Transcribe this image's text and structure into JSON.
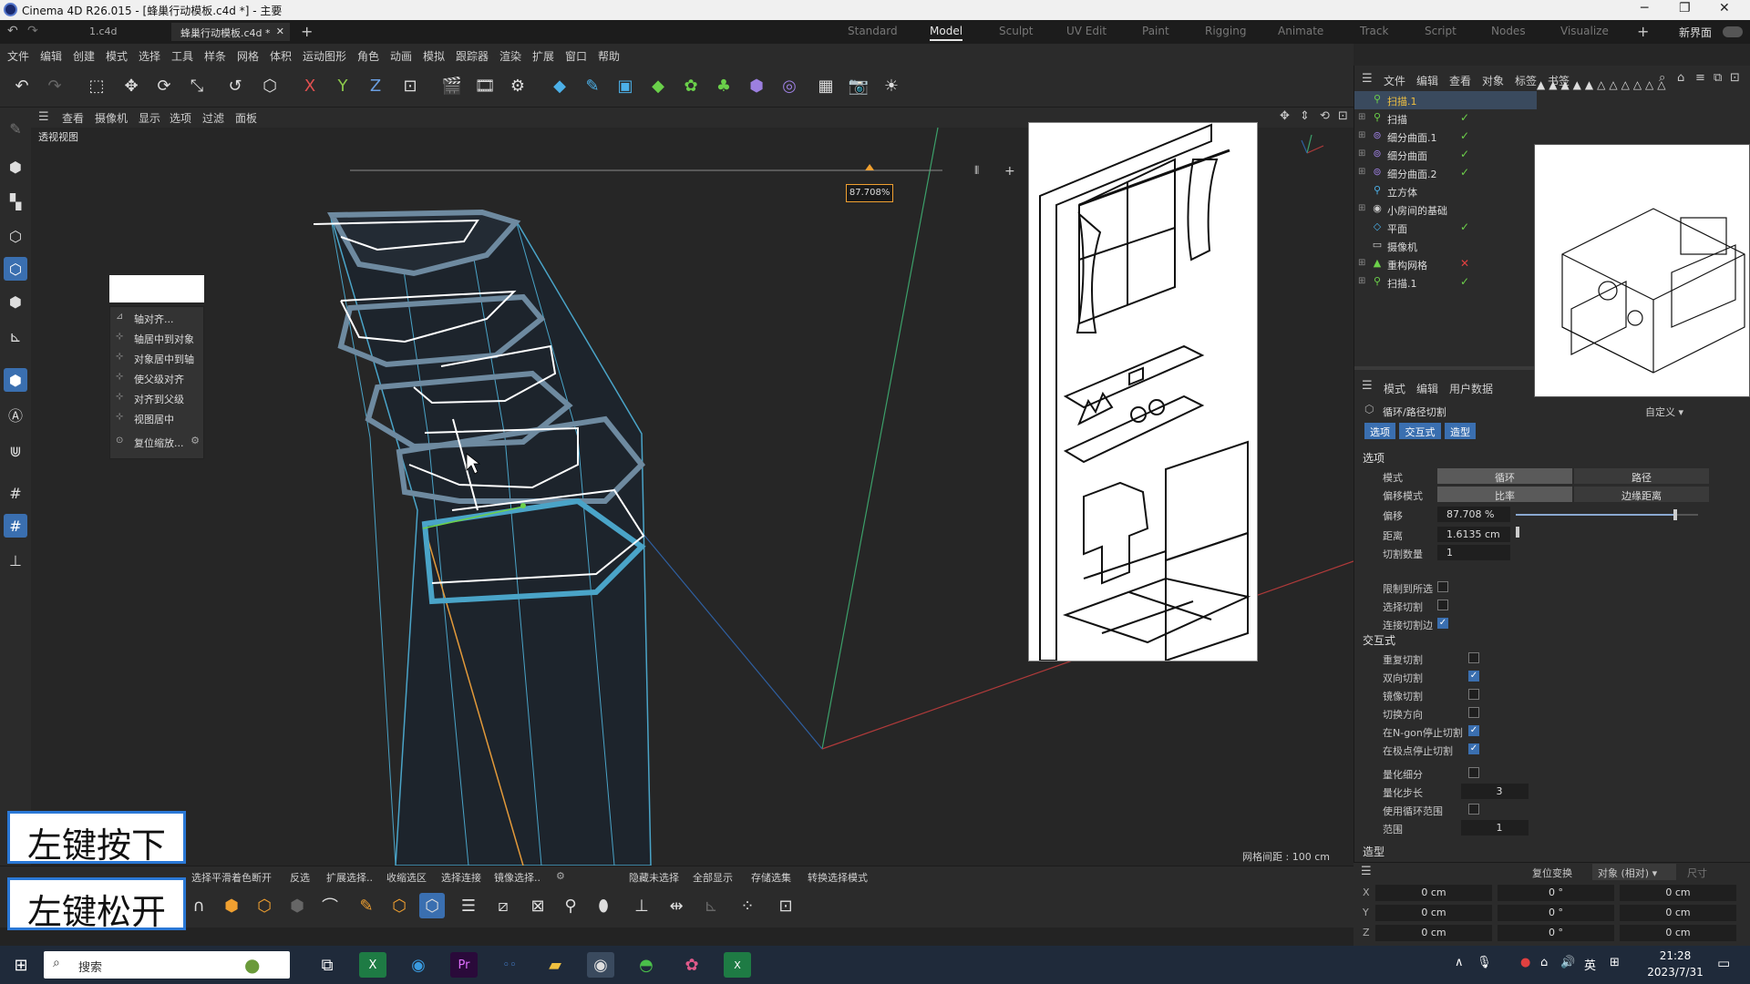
{
  "app": {
    "title": "Cinema 4D R26.015 - [蜂巢行动模板.c4d *] - 主要",
    "doc_tabs": [
      "1.c4d",
      "蜂巢行动模板.c4d *"
    ],
    "layouts": [
      "Standard",
      "Model",
      "Sculpt",
      "UV Edit",
      "Paint",
      "Rigging",
      "Animate",
      "Track",
      "Script",
      "Nodes",
      "Visualize"
    ],
    "active_layout": "Model",
    "new_interface": "新界面"
  },
  "menu": [
    "文件",
    "编辑",
    "创建",
    "模式",
    "选择",
    "工具",
    "样条",
    "网格",
    "体积",
    "运动图形",
    "角色",
    "动画",
    "模拟",
    "跟踪器",
    "渲染",
    "扩展",
    "窗口",
    "帮助"
  ],
  "toolbar": {
    "axis_labels": [
      "X",
      "Y",
      "Z"
    ]
  },
  "viewport": {
    "menu": [
      "查看",
      "摄像机",
      "显示",
      "选项",
      "过滤",
      "面板"
    ],
    "name": "透视视图",
    "percent_badge": "87.708%",
    "grid_spacing": "网格间距 : 100 cm",
    "slider_ratio": 0.87708
  },
  "context_menu": {
    "items": [
      "轴对齐...",
      "轴居中到对象",
      "对象居中到轴",
      "使父级对齐",
      "对齐到父级",
      "视图居中",
      "复位缩放..."
    ]
  },
  "bottom_bar": [
    "选择平滑着色断开",
    "反选",
    "扩展选择..",
    "收缩选区",
    "选择连接",
    "镜像选择..",
    "隐藏未选择",
    "全部显示",
    "存储选集",
    "转换选择模式"
  ],
  "object_manager": {
    "menu": [
      "文件",
      "编辑",
      "查看",
      "对象",
      "标签",
      "书签"
    ],
    "objects": [
      {
        "name": "扫描.1",
        "icon": "sweep-icon",
        "status": ""
      },
      {
        "name": "扫描",
        "icon": "sweep-icon",
        "status": "✓"
      },
      {
        "name": "细分曲面.1",
        "icon": "subdivision-icon",
        "status": "✓"
      },
      {
        "name": "细分曲面",
        "icon": "subdivision-icon",
        "status": "✓"
      },
      {
        "name": "细分曲面.2",
        "icon": "subdivision-icon",
        "status": "✓"
      },
      {
        "name": "立方体",
        "icon": "cube-icon",
        "status": ""
      },
      {
        "name": "小房间的基础",
        "icon": "null-icon",
        "status": ""
      },
      {
        "name": "平面",
        "icon": "plane-icon",
        "status": "✓"
      },
      {
        "name": "摄像机",
        "icon": "camera-icon",
        "status": ""
      },
      {
        "name": "重构网格",
        "icon": "remesh-icon",
        "status": "✕"
      },
      {
        "name": "扫描.1",
        "icon": "sweep-icon",
        "status": "✓"
      }
    ]
  },
  "attributes": {
    "menu": [
      "模式",
      "编辑",
      "用户数据"
    ],
    "tool_name": "循环/路径切割",
    "preset": "自定义",
    "tabs": [
      "选项",
      "交互式",
      "造型"
    ],
    "options_title": "选项",
    "mode_label": "模式",
    "mode_options": [
      "循环",
      "路径"
    ],
    "offset_mode_label": "偏移模式",
    "offset_mode_options": [
      "比率",
      "边缘距离"
    ],
    "offset_label": "偏移",
    "offset_value": "87.708 %",
    "offset_ratio": 0.87708,
    "distance_label": "距离",
    "distance_value": "1.6135 cm",
    "cuts_label": "切割数量",
    "cuts_value": "1",
    "checks1": [
      {
        "label": "限制到所选",
        "checked": false
      },
      {
        "label": "选择切割",
        "checked": false
      },
      {
        "label": "连接切割边",
        "checked": true
      }
    ],
    "interactive_title": "交互式",
    "checks2": [
      {
        "label": "重复切割",
        "checked": false
      },
      {
        "label": "双向切割",
        "checked": true
      },
      {
        "label": "镜像切割",
        "checked": false
      },
      {
        "label": "切换方向",
        "checked": false
      },
      {
        "label": "在N-gon停止切割",
        "checked": true
      },
      {
        "label": "在极点停止切割",
        "checked": true
      }
    ],
    "checks3": [
      {
        "label": "量化细分",
        "checked": false
      }
    ],
    "quant_step_label": "量化步长",
    "quant_step_value": "3",
    "use_loop_label": "使用循环范围",
    "range_label": "范围",
    "range_value": "1",
    "shape_title": "造型"
  },
  "coordinates": {
    "reset": "复位变换",
    "mode": "对象 (相对)",
    "size": "尺寸",
    "rows": [
      {
        "axis": "X",
        "p": "0 cm",
        "r": "0 °",
        "s": "0 cm"
      },
      {
        "axis": "Y",
        "p": "0 cm",
        "r": "0 °",
        "s": "0 cm"
      },
      {
        "axis": "Z",
        "p": "0 cm",
        "r": "0 °",
        "s": "0 cm"
      }
    ]
  },
  "captions": [
    "左键按下",
    "左键松开"
  ],
  "taskbar": {
    "search": "搜索",
    "time": "21:28",
    "date": "2023/7/31",
    "lang": "英"
  }
}
